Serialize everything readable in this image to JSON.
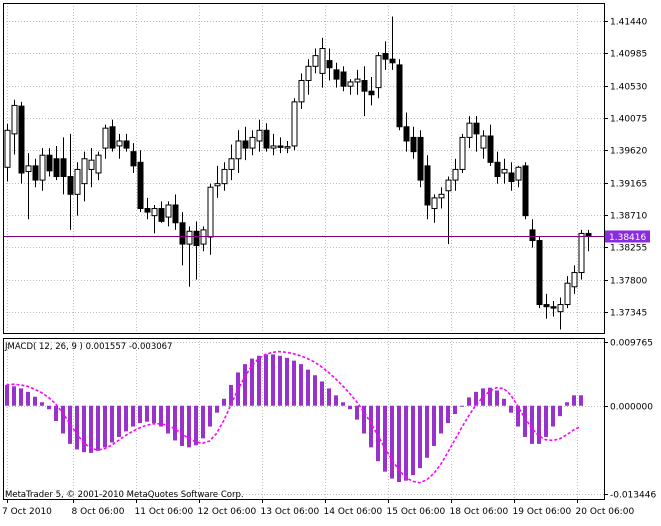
{
  "colors": {
    "background": "#ffffff",
    "grid": "#c0c0c0",
    "frame": "#000000",
    "bull_candle": "#ffffff",
    "bear_candle": "#000000",
    "bid_line": "#800080",
    "bid_label_bg": "#8a2be2",
    "histogram": "#9932cc",
    "signal": "#ff00ff"
  },
  "chart_data": [
    {
      "type": "candlestick",
      "name": "price",
      "y_ticks": [
        "1.41440",
        "1.40985",
        "1.40530",
        "1.40075",
        "1.39620",
        "1.39165",
        "1.38710",
        "1.38255",
        "1.37800",
        "1.37345"
      ],
      "ylim": [
        1.3705,
        1.4169
      ],
      "bid_price": 1.38416,
      "bid_label": "1.38416",
      "grid": true,
      "candles": [
        {
          "o": 1.3938,
          "h": 1.3999,
          "l": 1.3918,
          "c": 1.399
        },
        {
          "o": 1.3985,
          "h": 1.4033,
          "l": 1.3956,
          "c": 1.4025
        },
        {
          "o": 1.4024,
          "h": 1.403,
          "l": 1.3915,
          "c": 1.393
        },
        {
          "o": 1.3932,
          "h": 1.3958,
          "l": 1.3865,
          "c": 1.394
        },
        {
          "o": 1.394,
          "h": 1.395,
          "l": 1.391,
          "c": 1.392
        },
        {
          "o": 1.392,
          "h": 1.3965,
          "l": 1.3905,
          "c": 1.3955
        },
        {
          "o": 1.3955,
          "h": 1.3965,
          "l": 1.3925,
          "c": 1.3933
        },
        {
          "o": 1.395,
          "h": 1.3968,
          "l": 1.392,
          "c": 1.3925
        },
        {
          "o": 1.395,
          "h": 1.398,
          "l": 1.39,
          "c": 1.3925
        },
        {
          "o": 1.3925,
          "h": 1.3985,
          "l": 1.385,
          "c": 1.39
        },
        {
          "o": 1.39,
          "h": 1.3945,
          "l": 1.387,
          "c": 1.3935
        },
        {
          "o": 1.3915,
          "h": 1.396,
          "l": 1.389,
          "c": 1.395
        },
        {
          "o": 1.3935,
          "h": 1.3965,
          "l": 1.391,
          "c": 1.3948
        },
        {
          "o": 1.393,
          "h": 1.396,
          "l": 1.392,
          "c": 1.3955
        },
        {
          "o": 1.3965,
          "h": 1.3998,
          "l": 1.395,
          "c": 1.3993
        },
        {
          "o": 1.3995,
          "h": 1.4005,
          "l": 1.396,
          "c": 1.3965
        },
        {
          "o": 1.3968,
          "h": 1.3985,
          "l": 1.395,
          "c": 1.3975
        },
        {
          "o": 1.3975,
          "h": 1.3985,
          "l": 1.396,
          "c": 1.3965
        },
        {
          "o": 1.396,
          "h": 1.3972,
          "l": 1.393,
          "c": 1.394
        },
        {
          "o": 1.3945,
          "h": 1.3962,
          "l": 1.3875,
          "c": 1.388
        },
        {
          "o": 1.388,
          "h": 1.3895,
          "l": 1.3865,
          "c": 1.3875
        },
        {
          "o": 1.387,
          "h": 1.3885,
          "l": 1.3845,
          "c": 1.388
        },
        {
          "o": 1.388,
          "h": 1.389,
          "l": 1.386,
          "c": 1.3862
        },
        {
          "o": 1.3868,
          "h": 1.389,
          "l": 1.3855,
          "c": 1.3885
        },
        {
          "o": 1.3885,
          "h": 1.39,
          "l": 1.385,
          "c": 1.386
        },
        {
          "o": 1.386,
          "h": 1.3875,
          "l": 1.38,
          "c": 1.383
        },
        {
          "o": 1.383,
          "h": 1.3855,
          "l": 1.377,
          "c": 1.3848
        },
        {
          "o": 1.3848,
          "h": 1.3862,
          "l": 1.378,
          "c": 1.3828
        },
        {
          "o": 1.383,
          "h": 1.3855,
          "l": 1.382,
          "c": 1.385
        },
        {
          "o": 1.384,
          "h": 1.3915,
          "l": 1.3815,
          "c": 1.391
        },
        {
          "o": 1.3912,
          "h": 1.394,
          "l": 1.3895,
          "c": 1.3915
        },
        {
          "o": 1.3915,
          "h": 1.3945,
          "l": 1.3905,
          "c": 1.3935
        },
        {
          "o": 1.3935,
          "h": 1.397,
          "l": 1.392,
          "c": 1.395
        },
        {
          "o": 1.395,
          "h": 1.399,
          "l": 1.393,
          "c": 1.3975
        },
        {
          "o": 1.3975,
          "h": 1.3995,
          "l": 1.3948,
          "c": 1.3965
        },
        {
          "o": 1.3965,
          "h": 1.399,
          "l": 1.3955,
          "c": 1.398
        },
        {
          "o": 1.3975,
          "h": 1.4005,
          "l": 1.396,
          "c": 1.399
        },
        {
          "o": 1.399,
          "h": 1.4,
          "l": 1.396,
          "c": 1.3965
        },
        {
          "o": 1.3965,
          "h": 1.3985,
          "l": 1.3955,
          "c": 1.3968
        },
        {
          "o": 1.3968,
          "h": 1.398,
          "l": 1.3958,
          "c": 1.3966
        },
        {
          "o": 1.3965,
          "h": 1.3975,
          "l": 1.3958,
          "c": 1.3967
        },
        {
          "o": 1.3968,
          "h": 1.4035,
          "l": 1.3962,
          "c": 1.403
        },
        {
          "o": 1.403,
          "h": 1.407,
          "l": 1.402,
          "c": 1.406
        },
        {
          "o": 1.406,
          "h": 1.409,
          "l": 1.404,
          "c": 1.408
        },
        {
          "o": 1.408,
          "h": 1.4105,
          "l": 1.407,
          "c": 1.4095
        },
        {
          "o": 1.407,
          "h": 1.412,
          "l": 1.405,
          "c": 1.4105
        },
        {
          "o": 1.4088,
          "h": 1.4105,
          "l": 1.406,
          "c": 1.4078
        },
        {
          "o": 1.4075,
          "h": 1.4085,
          "l": 1.405,
          "c": 1.4062
        },
        {
          "o": 1.4072,
          "h": 1.408,
          "l": 1.4045,
          "c": 1.4052
        },
        {
          "o": 1.4052,
          "h": 1.4062,
          "l": 1.404,
          "c": 1.4058
        },
        {
          "o": 1.4058,
          "h": 1.4075,
          "l": 1.404,
          "c": 1.4062
        },
        {
          "o": 1.406,
          "h": 1.408,
          "l": 1.401,
          "c": 1.4045
        },
        {
          "o": 1.4045,
          "h": 1.4065,
          "l": 1.4025,
          "c": 1.404
        },
        {
          "o": 1.405,
          "h": 1.41,
          "l": 1.4035,
          "c": 1.4095
        },
        {
          "o": 1.4098,
          "h": 1.4115,
          "l": 1.4075,
          "c": 1.409
        },
        {
          "o": 1.409,
          "h": 1.415,
          "l": 1.4075,
          "c": 1.4085
        },
        {
          "o": 1.4082,
          "h": 1.409,
          "l": 1.399,
          "c": 1.3995
        },
        {
          "o": 1.3995,
          "h": 1.4015,
          "l": 1.396,
          "c": 1.3975
        },
        {
          "o": 1.398,
          "h": 1.3995,
          "l": 1.395,
          "c": 1.396
        },
        {
          "o": 1.398,
          "h": 1.399,
          "l": 1.391,
          "c": 1.392
        },
        {
          "o": 1.394,
          "h": 1.3955,
          "l": 1.3865,
          "c": 1.3885
        },
        {
          "o": 1.388,
          "h": 1.39,
          "l": 1.386,
          "c": 1.3895
        },
        {
          "o": 1.3895,
          "h": 1.391,
          "l": 1.388,
          "c": 1.39
        },
        {
          "o": 1.3905,
          "h": 1.3925,
          "l": 1.383,
          "c": 1.392
        },
        {
          "o": 1.392,
          "h": 1.395,
          "l": 1.3905,
          "c": 1.3935
        },
        {
          "o": 1.3935,
          "h": 1.3985,
          "l": 1.393,
          "c": 1.398
        },
        {
          "o": 1.398,
          "h": 1.401,
          "l": 1.3965,
          "c": 1.4
        },
        {
          "o": 1.4,
          "h": 1.401,
          "l": 1.396,
          "c": 1.3985
        },
        {
          "o": 1.3965,
          "h": 1.399,
          "l": 1.395,
          "c": 1.3982
        },
        {
          "o": 1.3982,
          "h": 1.3998,
          "l": 1.394,
          "c": 1.3945
        },
        {
          "o": 1.3945,
          "h": 1.396,
          "l": 1.3915,
          "c": 1.3925
        },
        {
          "o": 1.393,
          "h": 1.395,
          "l": 1.3915,
          "c": 1.3935
        },
        {
          "o": 1.393,
          "h": 1.3945,
          "l": 1.3905,
          "c": 1.3918
        },
        {
          "o": 1.392,
          "h": 1.394,
          "l": 1.391,
          "c": 1.3938
        },
        {
          "o": 1.394,
          "h": 1.3945,
          "l": 1.3865,
          "c": 1.387
        },
        {
          "o": 1.385,
          "h": 1.3865,
          "l": 1.3825,
          "c": 1.3835
        },
        {
          "o": 1.3835,
          "h": 1.384,
          "l": 1.374,
          "c": 1.3745
        },
        {
          "o": 1.3745,
          "h": 1.376,
          "l": 1.3725,
          "c": 1.3742
        },
        {
          "o": 1.3742,
          "h": 1.375,
          "l": 1.3728,
          "c": 1.374
        },
        {
          "o": 1.3735,
          "h": 1.3755,
          "l": 1.371,
          "c": 1.3745
        },
        {
          "o": 1.3745,
          "h": 1.3785,
          "l": 1.374,
          "c": 1.3775
        },
        {
          "o": 1.377,
          "h": 1.38,
          "l": 1.376,
          "c": 1.379
        },
        {
          "o": 1.379,
          "h": 1.385,
          "l": 1.378,
          "c": 1.3845
        },
        {
          "o": 1.3845,
          "h": 1.385,
          "l": 1.382,
          "c": 1.3842
        }
      ]
    },
    {
      "type": "bar+line",
      "name": "indicator",
      "label": "JMACD( 12, 26, 9 ) 0.001557 -0.003067",
      "y_ticks": [
        "0.009765",
        "0.000000",
        "-0.013446"
      ],
      "ylim": [
        -0.013446,
        0.009765
      ],
      "histogram": [
        0.003,
        0.0028,
        0.0025,
        0.002,
        0.0013,
        0.0005,
        -0.0005,
        -0.0022,
        -0.004,
        -0.0055,
        -0.0063,
        -0.0067,
        -0.0068,
        -0.0065,
        -0.006,
        -0.0053,
        -0.0045,
        -0.0037,
        -0.003,
        -0.0025,
        -0.0023,
        -0.0025,
        -0.003,
        -0.004,
        -0.005,
        -0.0058,
        -0.006,
        -0.0057,
        -0.0047,
        -0.003,
        -0.001,
        0.001,
        0.003,
        0.0048,
        0.006,
        0.0068,
        0.0072,
        0.0074,
        0.0074,
        0.0072,
        0.0069,
        0.0065,
        0.006,
        0.0052,
        0.0044,
        0.0035,
        0.0025,
        0.0015,
        0.0005,
        -0.0005,
        -0.002,
        -0.004,
        -0.006,
        -0.008,
        -0.0095,
        -0.0105,
        -0.011,
        -0.0108,
        -0.01,
        -0.009,
        -0.0075,
        -0.0058,
        -0.004,
        -0.0025,
        -0.0012,
        0.0,
        0.0012,
        0.002,
        0.0025,
        0.0026,
        0.0022,
        0.001,
        -0.001,
        -0.003,
        -0.0045,
        -0.0055,
        -0.0055,
        -0.0045,
        -0.003,
        -0.0015,
        0.0005,
        0.0015,
        0.0015
      ],
      "signal": [
        0.003,
        0.0031,
        0.003,
        0.0028,
        0.0024,
        0.0019,
        0.0012,
        0.0003,
        -0.001,
        -0.0025,
        -0.004,
        -0.0053,
        -0.0061,
        -0.0064,
        -0.0062,
        -0.0057,
        -0.005,
        -0.0043,
        -0.0037,
        -0.0032,
        -0.0028,
        -0.0026,
        -0.0026,
        -0.0028,
        -0.0033,
        -0.004,
        -0.0047,
        -0.0052,
        -0.0054,
        -0.0051,
        -0.004,
        -0.0022,
        0.0,
        0.0022,
        0.0041,
        0.0057,
        0.0068,
        0.0074,
        0.0077,
        0.0078,
        0.0077,
        0.0075,
        0.0072,
        0.0068,
        0.0063,
        0.0056,
        0.0048,
        0.0039,
        0.0029,
        0.0018,
        0.0006,
        -0.0008,
        -0.0024,
        -0.0042,
        -0.006,
        -0.0077,
        -0.0092,
        -0.0103,
        -0.0109,
        -0.0111,
        -0.0107,
        -0.0098,
        -0.0085,
        -0.0068,
        -0.005,
        -0.0032,
        -0.0015,
        0.0,
        0.0012,
        0.0021,
        0.0026,
        0.0025,
        0.0016,
        0.0,
        -0.0017,
        -0.0032,
        -0.0043,
        -0.0049,
        -0.005,
        -0.0048,
        -0.0042,
        -0.0035,
        -0.003
      ],
      "grid": true
    }
  ],
  "x_labels": [
    "7 Oct 2010",
    "8 Oct 06:00",
    "11 Oct 06:00",
    "12 Oct 06:00",
    "13 Oct 06:00",
    "14 Oct 06:00",
    "15 Oct 06:00",
    "18 Oct 06:00",
    "19 Oct 06:00",
    "20 Oct 06:00"
  ],
  "copyright": "MetaTrader 5, © 2001-2010 MetaQuotes Software Corp."
}
